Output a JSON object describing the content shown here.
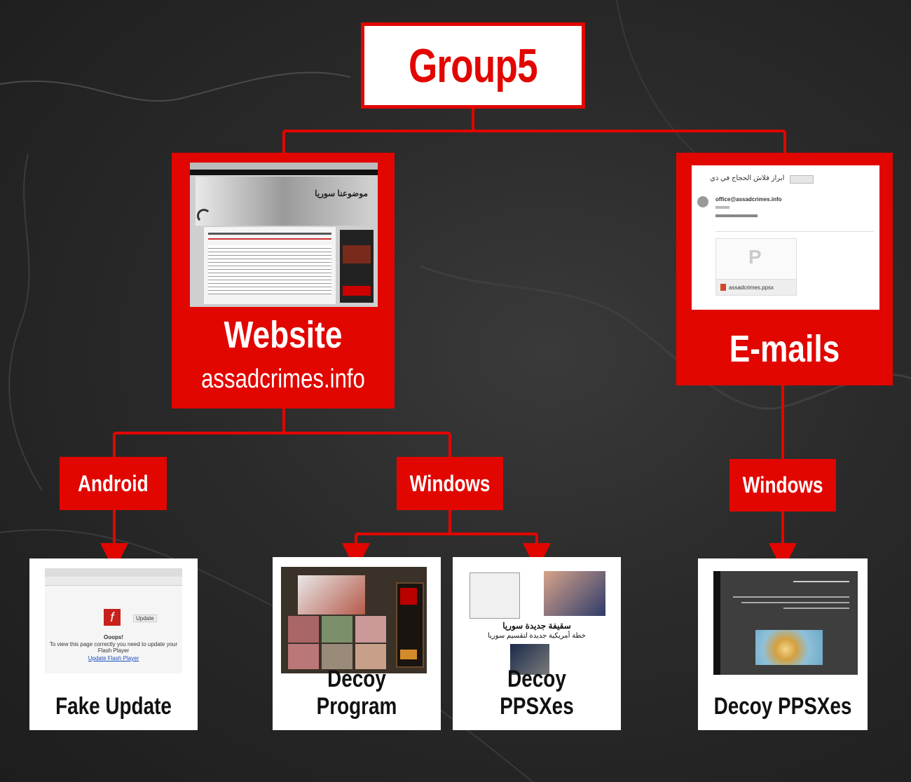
{
  "root": {
    "title": "Group5"
  },
  "branches": {
    "website": {
      "title": "Website",
      "subtitle": "assadcrimes.info"
    },
    "emails": {
      "title": "E-mails"
    }
  },
  "platforms": {
    "android": "Android",
    "windows_web": "Windows",
    "windows_mail": "Windows"
  },
  "leaves": {
    "fake_update": "Fake Update",
    "decoy_program": "Decoy Program",
    "decoy_ppsx_web": "Decoy PPSXes",
    "decoy_ppsx_mail": "Decoy PPSXes"
  },
  "screenshots": {
    "email_sender": "office@assadcrimes.info",
    "email_subject": "ابراز فلاش الحجاج في ذي",
    "email_attachment": "assadcrimes.ppsx",
    "website_banner": "موضوعنا سوريا",
    "flash_heading": "Ooops!",
    "flash_line": "To view this page correctly you need to update your Flash Player",
    "flash_link": "Update Flash Player",
    "flash_button": "Update",
    "ppsx_arabic_1": "سقيفة جديدة سوريا",
    "ppsx_arabic_2": "خطة أمريكية جديدة لتقسيم سوريا"
  },
  "colors": {
    "accent": "#e10600",
    "background": "#222222",
    "card": "#ffffff"
  }
}
